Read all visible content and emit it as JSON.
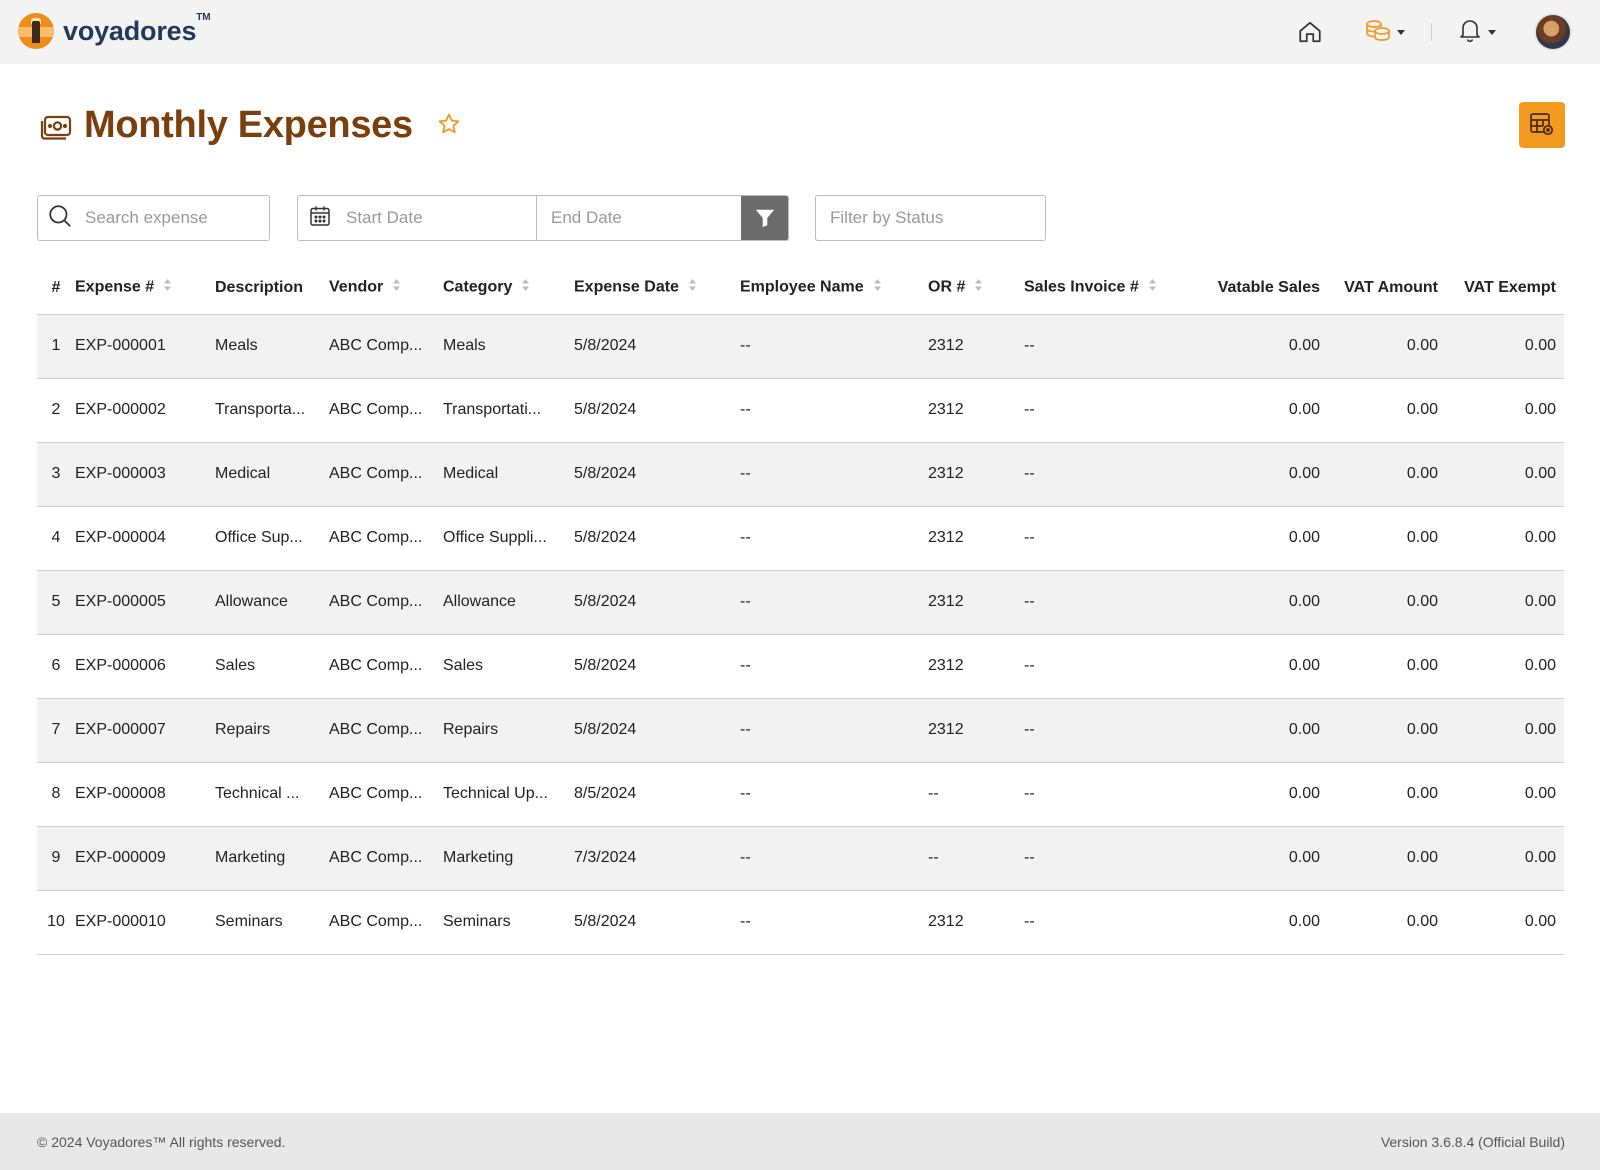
{
  "brand": {
    "name": "voyadores",
    "tm": "TM"
  },
  "page": {
    "title": "Monthly Expenses"
  },
  "filters": {
    "search_placeholder": "Search expense",
    "start_date_placeholder": "Start Date",
    "end_date_placeholder": "End Date",
    "status_placeholder": "Filter by Status"
  },
  "table": {
    "headers": [
      "#",
      "Expense #",
      "Description",
      "Vendor",
      "Category",
      "Expense Date",
      "Employee Name",
      "OR #",
      "Sales Invoice #",
      "Vatable Sales",
      "VAT Amount",
      "VAT Exempt"
    ],
    "rows": [
      [
        "1",
        "EXP-000001",
        "Meals",
        "ABC Comp...",
        "Meals",
        "5/8/2024",
        "--",
        "2312",
        "--",
        "0.00",
        "0.00",
        "0.00"
      ],
      [
        "2",
        "EXP-000002",
        "Transporta...",
        "ABC Comp...",
        "Transportati...",
        "5/8/2024",
        "--",
        "2312",
        "--",
        "0.00",
        "0.00",
        "0.00"
      ],
      [
        "3",
        "EXP-000003",
        "Medical",
        "ABC Comp...",
        "Medical",
        "5/8/2024",
        "--",
        "2312",
        "--",
        "0.00",
        "0.00",
        "0.00"
      ],
      [
        "4",
        "EXP-000004",
        "Office Sup...",
        "ABC Comp...",
        "Office Suppli...",
        "5/8/2024",
        "--",
        "2312",
        "--",
        "0.00",
        "0.00",
        "0.00"
      ],
      [
        "5",
        "EXP-000005",
        "Allowance",
        "ABC Comp...",
        "Allowance",
        "5/8/2024",
        "--",
        "2312",
        "--",
        "0.00",
        "0.00",
        "0.00"
      ],
      [
        "6",
        "EXP-000006",
        "Sales",
        "ABC Comp...",
        "Sales",
        "5/8/2024",
        "--",
        "2312",
        "--",
        "0.00",
        "0.00",
        "0.00"
      ],
      [
        "7",
        "EXP-000007",
        "Repairs",
        "ABC Comp...",
        "Repairs",
        "5/8/2024",
        "--",
        "2312",
        "--",
        "0.00",
        "0.00",
        "0.00"
      ],
      [
        "8",
        "EXP-000008",
        "Technical ...",
        "ABC Comp...",
        "Technical Up...",
        "8/5/2024",
        "--",
        "--",
        "--",
        "0.00",
        "0.00",
        "0.00"
      ],
      [
        "9",
        "EXP-000009",
        "Marketing",
        "ABC Comp...",
        "Marketing",
        "7/3/2024",
        "--",
        "--",
        "--",
        "0.00",
        "0.00",
        "0.00"
      ],
      [
        "10",
        "EXP-000010",
        "Seminars",
        "ABC Comp...",
        "Seminars",
        "5/8/2024",
        "--",
        "2312",
        "--",
        "0.00",
        "0.00",
        "0.00"
      ]
    ]
  },
  "footer": {
    "copyright": "© 2024 Voyadores™ All rights reserved.",
    "version": "Version 3.6.8.4 (Official Build)"
  },
  "colors": {
    "accent": "#f39a21",
    "title": "#7a3f0c",
    "brand_text": "#1f3a5a"
  },
  "icons": [
    "lighthouse-logo-icon",
    "home-icon",
    "coins-icon",
    "bell-icon",
    "money-icon",
    "star-icon",
    "table-export-icon",
    "search-icon",
    "calendar-icon",
    "filter-icon",
    "chevron-down-icon",
    "sort-icon"
  ]
}
